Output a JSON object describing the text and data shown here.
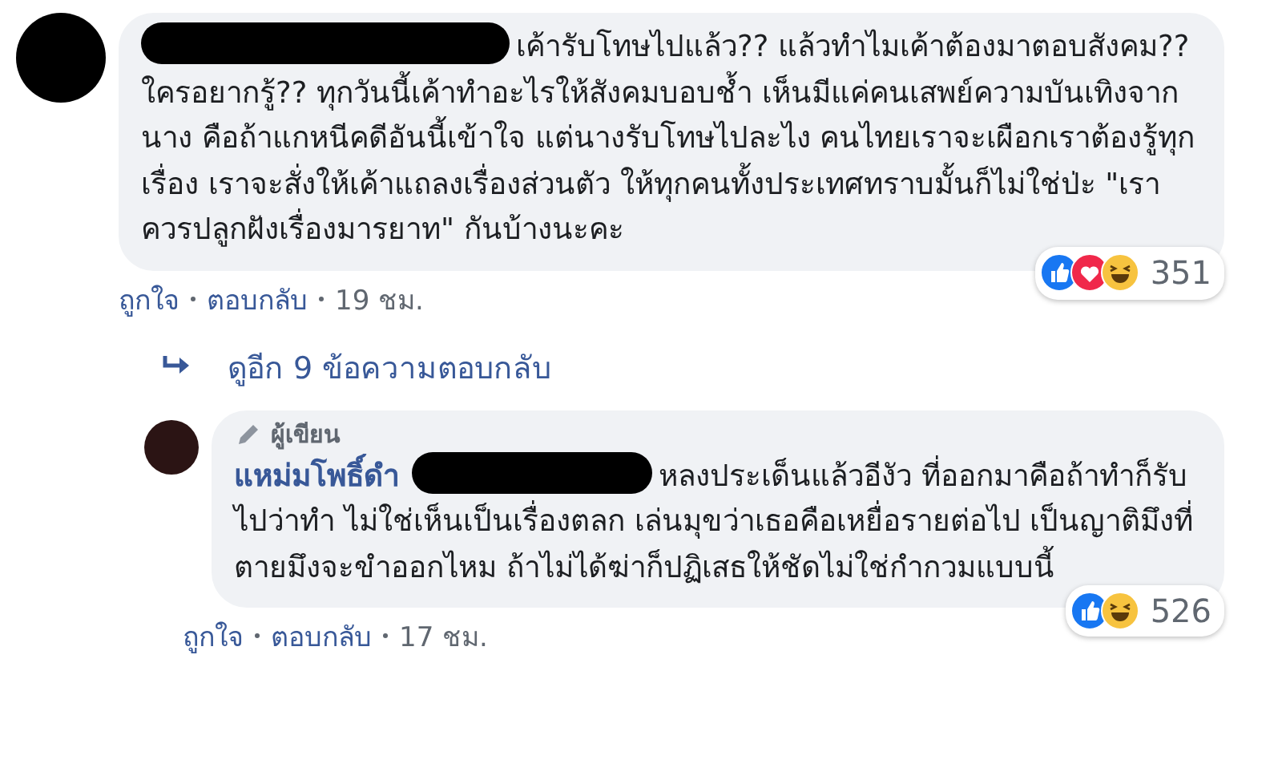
{
  "comments": [
    {
      "redacted": true,
      "text": "เค้ารับโทษไปแล้ว?? แล้วทำไมเค้าต้องมาตอบสังคม?? ใครอยากรู้?? ทุกวันนี้เค้าทำอะไรให้สังคมบอบช้ำ เห็นมีแค่คนเสพย์ความบันเทิงจากนาง คือถ้าแกหนีคดีอันนี้เข้าใจ แต่นางรับโทษไปละไง คนไทยเราจะเผือกเราต้องรู้ทุกเรื่อง เราจะสั่งให้เค้าแถลงเรื่องส่วนตัว ให้ทุกคนทั้งประเทศทราบมั้นก็ไม่ใช่ป่ะ \"เราควรปลูกฝังเรื่องมารยาท\" กันบ้างนะคะ",
      "reactions": [
        {
          "kind": "like"
        },
        {
          "kind": "love"
        },
        {
          "kind": "haha"
        }
      ],
      "reaction_count": "351",
      "actions": [
        "ถูกใจ",
        "ตอบกลับ",
        "19 ชม."
      ],
      "more_replies": "ดูอีก 9 ข้อความตอบกลับ",
      "is_reply": false
    },
    {
      "author": "แหม่มโพธิ์ดำ",
      "badge": "ผู้เขียน",
      "redacted": true,
      "text": "หลงประเด็นแล้วอีงัว ที่ออกมาคือถ้าทำก็รับไปว่าทำ ไม่ใช่เห็นเป็นเรื่องตลก เล่นมุขว่าเธอคือเหยื่อรายต่อไป เป็นญาติมึงที่ตายมึงจะขำออกไหม ถ้าไม่ได้ฆ่าก็ปฏิเสธให้ชัดไม่ใช่กำกวมแบบนี้",
      "reactions": [
        {
          "kind": "like"
        },
        {
          "kind": "haha"
        }
      ],
      "reaction_count": "526",
      "actions": [
        "ถูกใจ",
        "ตอบกลับ",
        "17 ชม."
      ],
      "is_reply": true
    }
  ]
}
